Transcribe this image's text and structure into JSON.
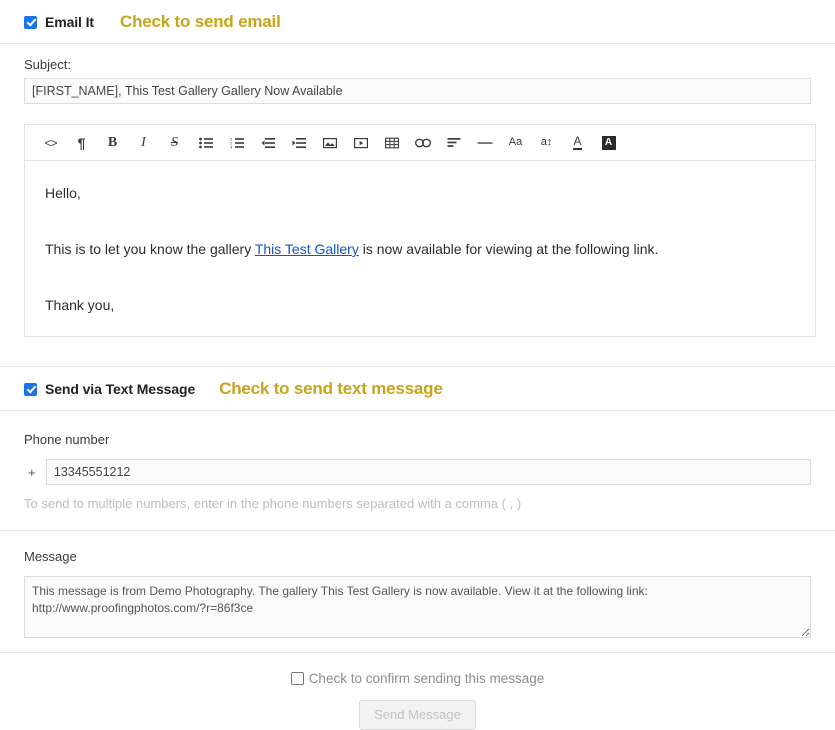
{
  "email_section": {
    "checkbox_label": "Email It",
    "checkbox_checked": true,
    "hint": "Check to send email",
    "hint_color": "#c9a41a",
    "subject": {
      "label": "Subject:",
      "value": "[FIRST_NAME], This Test Gallery Gallery Now Available",
      "placeholder": ""
    },
    "editor": {
      "toolbar": [
        {
          "name": "code-icon",
          "glyph": "<>"
        },
        {
          "name": "paragraph-icon",
          "glyph": "¶"
        },
        {
          "name": "bold-icon",
          "glyph": "B"
        },
        {
          "name": "italic-icon",
          "glyph": "I"
        },
        {
          "name": "strikethrough-icon",
          "glyph": "S"
        },
        {
          "name": "unordered-list-icon",
          "glyph": ""
        },
        {
          "name": "ordered-list-icon",
          "glyph": ""
        },
        {
          "name": "outdent-icon",
          "glyph": ""
        },
        {
          "name": "indent-icon",
          "glyph": ""
        },
        {
          "name": "insert-image-icon",
          "glyph": ""
        },
        {
          "name": "insert-video-icon",
          "glyph": ""
        },
        {
          "name": "insert-table-icon",
          "glyph": ""
        },
        {
          "name": "insert-link-icon",
          "glyph": ""
        },
        {
          "name": "align-icon",
          "glyph": ""
        },
        {
          "name": "horizontal-rule-icon",
          "glyph": "—"
        },
        {
          "name": "font-size-icon",
          "glyph": "Aa"
        },
        {
          "name": "line-height-icon",
          "glyph": "a↕"
        },
        {
          "name": "font-color-icon",
          "glyph": "A"
        },
        {
          "name": "background-color-icon",
          "glyph": "A"
        }
      ],
      "body": {
        "greeting": "Hello,",
        "line_before_link": "This is to let you know the gallery ",
        "link_text": "This Test Gallery",
        "line_after_link": " is now available for viewing at the following link.",
        "closing": "Thank you,"
      }
    }
  },
  "sms_section": {
    "checkbox_label": "Send via Text Message",
    "checkbox_checked": true,
    "hint": "Check to send text message",
    "phone": {
      "label": "Phone number",
      "prefix": "+",
      "value": "13345551212",
      "placeholder": "",
      "hint": "To send to multiple numbers, enter in the phone numbers separated with a comma ( , )"
    },
    "message": {
      "label": "Message",
      "value": "This message is from Demo Photography. The gallery This Test Gallery is now available. View it at the following link: http://www.proofingphotos.com/?r=86f3ce",
      "placeholder": ""
    }
  },
  "footer": {
    "confirm_label": "Check to confirm sending this message",
    "confirm_checked": false,
    "send_button_label": "Send Message",
    "send_button_disabled": true
  }
}
